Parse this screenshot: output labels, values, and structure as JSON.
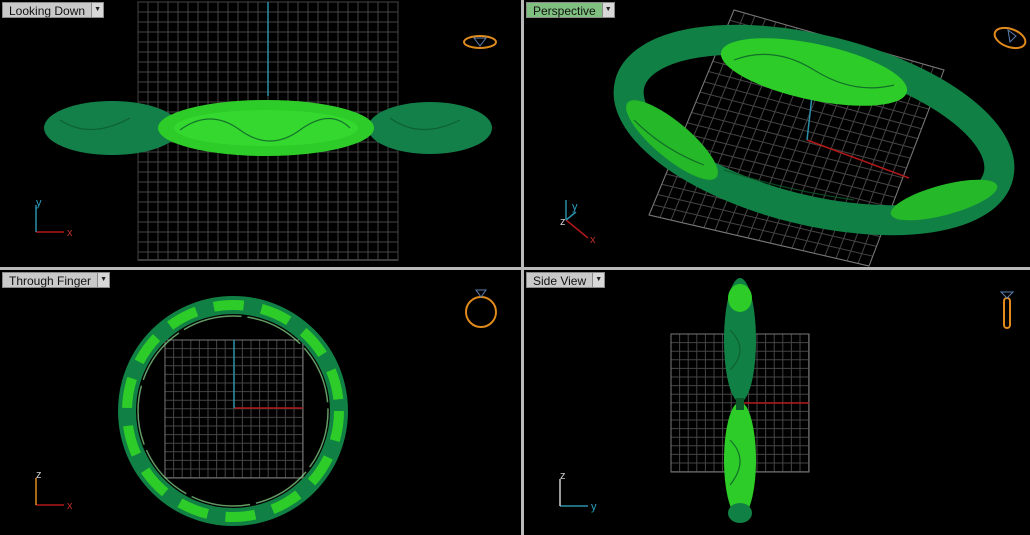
{
  "viewports": {
    "top": {
      "label": "Looking Down"
    },
    "persp": {
      "label": "Perspective"
    },
    "front": {
      "label": "Through Finger"
    },
    "right": {
      "label": "Side View"
    }
  },
  "axes": {
    "top": {
      "vertical": "y",
      "horizontal": "x"
    },
    "persp": {
      "vertical": "y",
      "depth": "z",
      "horizontal": "x"
    },
    "front": {
      "vertical": "z",
      "horizontal": "x"
    },
    "right": {
      "vertical": "z",
      "horizontal": "y"
    }
  },
  "icons": {
    "dropdown": "chevron-down-icon",
    "view_cube": "ring-view-icon"
  },
  "colors": {
    "viewport_bg": "#000000",
    "active_tab": "#7fbf7f",
    "grid": "#5a5a5a",
    "axis_x": "#b01818",
    "axis_y": "#2a8fa8",
    "ring_bright": "#2fd52a",
    "ring_dark": "#106e3a",
    "icon_orange": "#e08a1c"
  }
}
